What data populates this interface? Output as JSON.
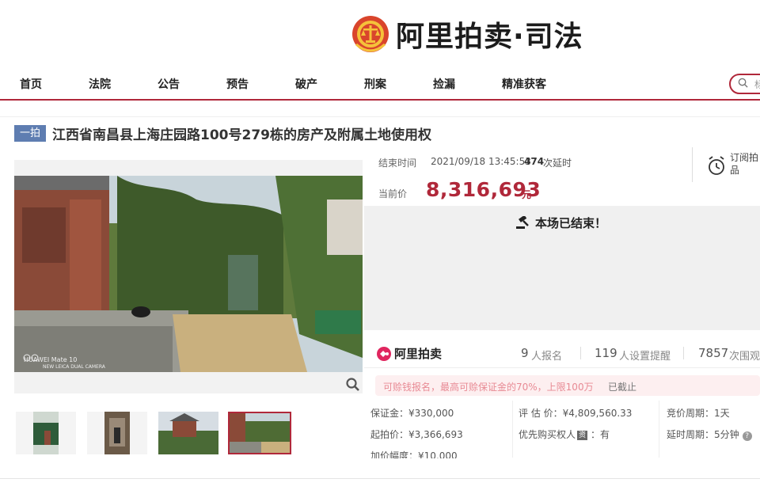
{
  "brand": {
    "name": "阿里拍卖·司法"
  },
  "nav": {
    "items": [
      "首页",
      "法院",
      "公告",
      "预告",
      "破产",
      "刑案",
      "捡漏",
      "精准获客"
    ]
  },
  "search": {
    "placeholder": "标"
  },
  "auction": {
    "tag": "一拍",
    "title": "江西省南昌县上海庄园路100号279栋的房产及附属土地使用权",
    "end_time_label": "结束时间",
    "end_time": "2021/09/18 13:45:53",
    "delay_count": "474",
    "delay_unit": "次延时",
    "price_label": "当前价",
    "price": "8,316,693",
    "price_unit": "元",
    "subscribe": "订阅拍品",
    "ended": "本场已结束！"
  },
  "photo": {
    "watermark_line1": "HUAWEI Mate 10",
    "watermark_line2": "NEW LEICA DUAL CAMERA"
  },
  "stats": {
    "platform": "阿里拍卖",
    "signups_num": "9",
    "signups_label": "人报名",
    "reminders_num": "119",
    "reminders_label": "人设置提醒",
    "views_num": "7857",
    "views_label": "次围观"
  },
  "notice": {
    "text": "可赊钱报名，最高可赊保证金的70%，上限100万",
    "status": "已截止"
  },
  "details": {
    "deposit": "保证金：¥330,000",
    "starting": "起拍价：¥3,366,693",
    "increment": "加价幅度：¥10,000",
    "appraisal": "评 估 价：¥4,809,560.33",
    "priority_label": "优先购买权人",
    "priority_badge": "资",
    "priority_value": "：有",
    "cycle": "竞价周期：1天",
    "extension": "延时周期：5分钟"
  },
  "colors": {
    "accent": "#b0283a",
    "tag": "#5e7db1",
    "notice_bg": "#fdeff0",
    "ali_pink": "#e0265f"
  }
}
